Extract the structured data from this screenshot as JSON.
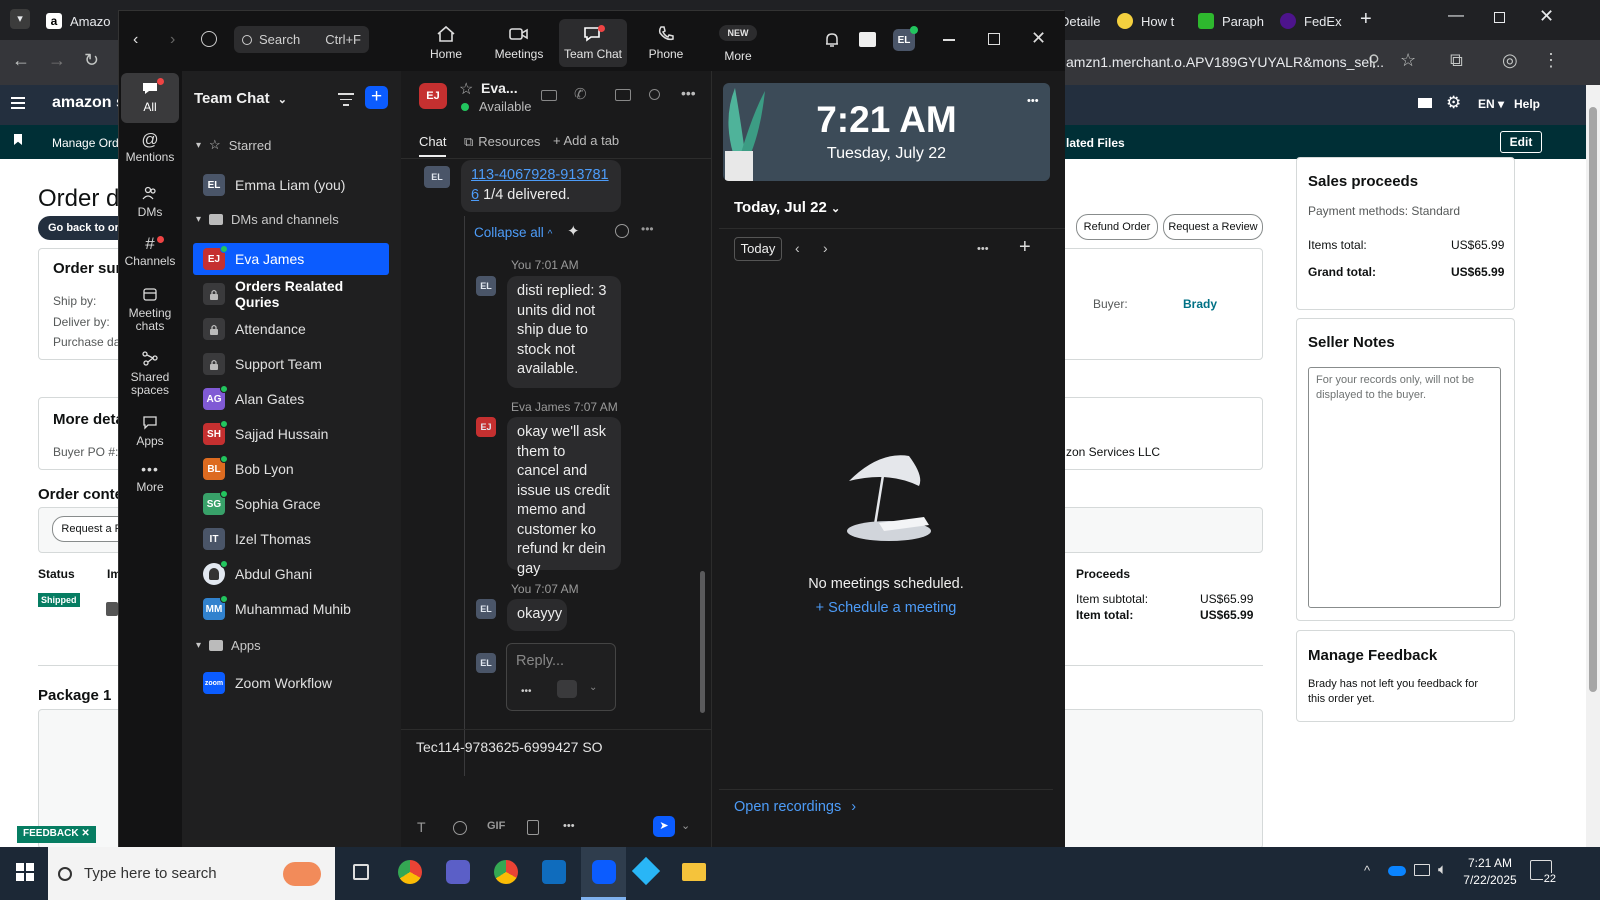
{
  "browser": {
    "tabs": [
      {
        "label": "Amazo",
        "color": "#232f3e"
      },
      {
        "label": "Detaile",
        "color": "#4285f4"
      },
      {
        "label": "How t",
        "color": "#f4d03f"
      },
      {
        "label": "Paraph",
        "color": "#2eb82e"
      },
      {
        "label": "FedEx",
        "color": "#4d148c"
      }
    ],
    "url": "amzn1.merchant.o.APV189GYUYALR&mons_sel..."
  },
  "amazon": {
    "logo": "amazon sel",
    "nav_lang": "EN",
    "nav_help": "Help",
    "manage_orders": "Manage Order",
    "related_files": "lated Files",
    "edit": "Edit",
    "page_title": "Order de",
    "back_button": "Go back to ord",
    "order_summary": "Order sun",
    "ship_by": "Ship by:",
    "deliver_by": "Deliver by:",
    "purchase_date": "Purchase dat",
    "refund_order": "Refund Order",
    "request_review": "Request a Review",
    "buyer_label": "Buyer:",
    "buyer_name": "Brady",
    "more_details": "More deta",
    "buyer_po": "Buyer PO #:",
    "services": "zon Services LLC",
    "order_contents": "Order conte",
    "request_a_r": "Request a R",
    "col_status": "Status",
    "col_image": "Im",
    "col_proceeds": "Proceeds",
    "status_badge": "Shipped",
    "item_subtotal_label": "Item subtotal:",
    "item_subtotal": "US$65.99",
    "item_total_label": "Item total:",
    "item_total": "US$65.99",
    "package": "Package 1",
    "feedback_tab": "FEEDBACK",
    "sales_proceeds": "Sales proceeds",
    "payment_methods": "Payment methods: Standard",
    "items_total_label": "Items total:",
    "items_total": "US$65.99",
    "grand_total_label": "Grand total:",
    "grand_total": "US$65.99",
    "seller_notes": "Seller Notes",
    "notes_placeholder": "For your records only, will not be displayed to the buyer.",
    "manage_feedback": "Manage Feedback",
    "feedback_text": "Brady has not left you feedback for this order yet."
  },
  "zoom": {
    "search_label": "Search",
    "search_shortcut": "Ctrl+F",
    "top_nav": [
      {
        "label": "Home",
        "icon": "home-icon"
      },
      {
        "label": "Meetings",
        "icon": "video-icon"
      },
      {
        "label": "Team Chat",
        "icon": "chat-icon"
      },
      {
        "label": "Phone",
        "icon": "phone-icon"
      },
      {
        "label": "More",
        "icon": "more-icon",
        "badge": "NEW"
      }
    ],
    "profile_initials": "EL",
    "rail": [
      {
        "label": "All",
        "icon": "chat-bubble-icon"
      },
      {
        "label": "Mentions",
        "icon": "at-icon"
      },
      {
        "label": "DMs",
        "icon": "people-icon"
      },
      {
        "label": "Channels",
        "icon": "hash-icon"
      },
      {
        "label": "Meeting chats",
        "icon": "calendar-icon"
      },
      {
        "label": "Shared spaces",
        "icon": "share-icon"
      },
      {
        "label": "Apps",
        "icon": "apps-icon"
      },
      {
        "label": "More",
        "icon": "ellipsis-icon"
      }
    ],
    "list_title": "Team Chat",
    "starred_label": "Starred",
    "starred": [
      {
        "initials": "EL",
        "name": "Emma Liam (you)",
        "color": "#4a5568"
      }
    ],
    "dms_label": "DMs and channels",
    "channels": [
      {
        "initials": "EJ",
        "name": "Eva James",
        "color": "#c53030",
        "type": "dm",
        "selected": true
      },
      {
        "initials": "",
        "name": "Orders Realated Quries",
        "color": "#3a3a3c",
        "type": "lock",
        "bold": true
      },
      {
        "initials": "",
        "name": "Attendance",
        "color": "#3a3a3c",
        "type": "lock"
      },
      {
        "initials": "",
        "name": "Support Team",
        "color": "#3a3a3c",
        "type": "lock"
      },
      {
        "initials": "AG",
        "name": "Alan Gates",
        "color": "#805ad5",
        "type": "dm"
      },
      {
        "initials": "SH",
        "name": "Sajjad Hussain",
        "color": "#c53030",
        "type": "dm"
      },
      {
        "initials": "BL",
        "name": "Bob Lyon",
        "color": "#dd6b20",
        "type": "dm"
      },
      {
        "initials": "SG",
        "name": "Sophia Grace",
        "color": "#38a169",
        "type": "dm"
      },
      {
        "initials": "IT",
        "name": "Izel Thomas",
        "color": "#4a5568",
        "type": "dm"
      },
      {
        "initials": "",
        "name": "Abdul Ghani",
        "color": "#e2e8f0",
        "type": "photo"
      },
      {
        "initials": "MM",
        "name": "Muhammad Muhib",
        "color": "#3182ce",
        "type": "dm"
      }
    ],
    "apps_label": "Apps",
    "apps": [
      {
        "name": "Zoom Workflow",
        "icon_text": "zoom"
      }
    ],
    "chat": {
      "contact_initials": "EJ",
      "contact_name": "Eva...",
      "contact_status": "Available",
      "tabs": {
        "chat": "Chat",
        "resources": "Resources",
        "add": "Add a tab"
      },
      "link_text_1": "113-4067928-913781",
      "link_text_2": "6",
      "link_suffix": " 1/4 delivered.",
      "collapse": "Collapse all",
      "messages": [
        {
          "sender": "You",
          "time": "7:01 AM",
          "initials": "EL",
          "text": "disti replied: 3 units did not ship due to stock not available."
        },
        {
          "sender": "Eva James",
          "time": "7:07 AM",
          "initials": "EJ",
          "text": "okay we'll ask them to cancel and issue us credit memo and customer ko refund kr dein gay"
        },
        {
          "sender": "You",
          "time": "7:07 AM",
          "initials": "EL",
          "text": "okayyy"
        }
      ],
      "reply_placeholder": "Reply...",
      "compose_text": "Tec114-9783625-6999427 SO"
    },
    "calendar": {
      "time": "7:21 AM",
      "date": "Tuesday, July 22",
      "today_header": "Today, Jul 22",
      "today_button": "Today",
      "empty_text": "No meetings scheduled.",
      "schedule_link": "Schedule a meeting",
      "open_recordings": "Open recordings"
    }
  },
  "taskbar": {
    "search_placeholder": "Type here to search",
    "time": "7:21 AM",
    "date": "7/22/2025",
    "notification_count": "22"
  }
}
